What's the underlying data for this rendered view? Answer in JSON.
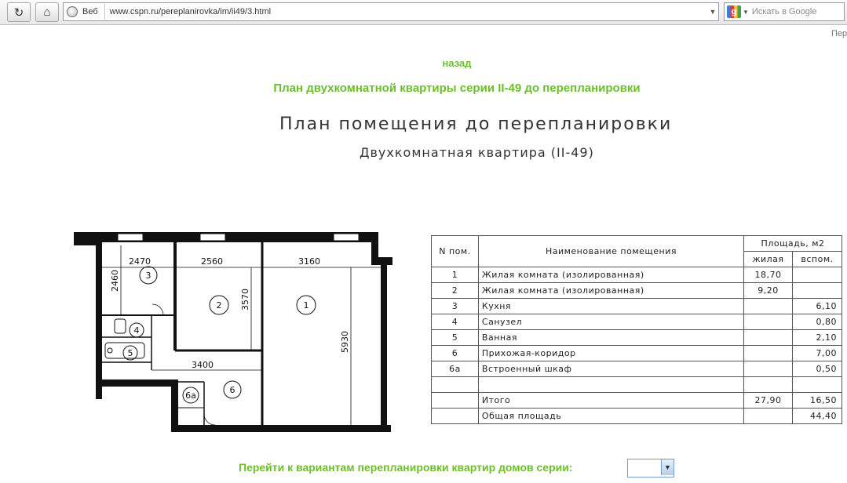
{
  "browser": {
    "search_engine_label": "Веб",
    "url": "www.cspn.ru/pereplanirovka/im/ii49/3.html",
    "search_placeholder": "Искать в Google",
    "edge_text": "Пер"
  },
  "page": {
    "back_link": "назад",
    "title": "План двухкомнатной квартиры серии II-49 до перепланировки",
    "drawing_title": "План помещения до перепланировки",
    "drawing_subtitle": "Двухкомнатная квартира (II-49)",
    "bottom_text": "Перейти к вариантам перепланировки квартир домов серии:",
    "select_value": ""
  },
  "plan": {
    "dimensions": [
      "2470",
      "2560",
      "3160",
      "2460",
      "3570",
      "5930",
      "3400"
    ],
    "room_numbers": [
      "1",
      "2",
      "3",
      "4",
      "5",
      "6",
      "6а"
    ]
  },
  "table": {
    "header": {
      "num": "N пом.",
      "name": "Наименование помещения",
      "area": "Площадь,  м2",
      "living": "жилая",
      "aux": "вспом."
    },
    "rows": [
      {
        "num": "1",
        "name": "Жилая комната (изолированная)",
        "living": "18,70",
        "aux": ""
      },
      {
        "num": "2",
        "name": "Жилая комната (изолированная)",
        "living": "9,20",
        "aux": ""
      },
      {
        "num": "3",
        "name": "Кухня",
        "living": "",
        "aux": "6,10"
      },
      {
        "num": "4",
        "name": "Санузел",
        "living": "",
        "aux": "0,80"
      },
      {
        "num": "5",
        "name": "Ванная",
        "living": "",
        "aux": "2,10"
      },
      {
        "num": "6",
        "name": "Прихожая-коридор",
        "living": "",
        "aux": "7,00"
      },
      {
        "num": "6а",
        "name": "Встроенный шкаф",
        "living": "",
        "aux": "0,50"
      }
    ],
    "total_label": "Итого",
    "total_living": "27,90",
    "total_aux": "16,50",
    "overall_label": "Общая площадь",
    "overall_value": "44,40"
  }
}
